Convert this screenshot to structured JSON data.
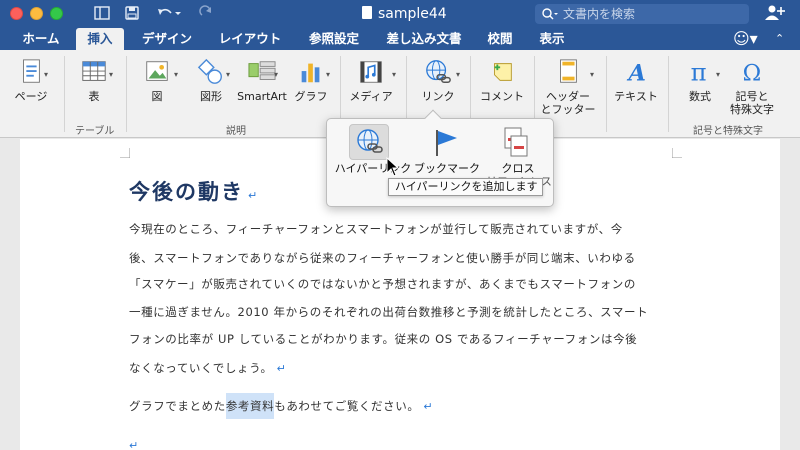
{
  "window": {
    "title": "sample44",
    "search_placeholder": "文書内を検索"
  },
  "tabs": [
    "ホーム",
    "挿入",
    "デザイン",
    "レイアウト",
    "参照設定",
    "差し込み文書",
    "校閲",
    "表示"
  ],
  "active_tab": "挿入",
  "ribbon": {
    "page": "ページ",
    "table": "表",
    "table_group": "テーブル",
    "figure": "図",
    "shapes": "図形",
    "smartart": "SmartArt",
    "graph": "グラフ",
    "illus_group": "説明",
    "media": "メディア",
    "link": "リンク",
    "comment": "コメント",
    "header_footer_1": "ヘッダー",
    "header_footer_2": "とフッター",
    "text": "テキスト",
    "equation": "数式",
    "symbol_1": "記号と",
    "symbol_2": "特殊文字",
    "symbol_group": "記号と特殊文字"
  },
  "popup": {
    "hyperlink": "ハイパーリンク",
    "bookmark": "ブックマーク",
    "crossref_1": "クロス",
    "crossref_2": "リファレンス",
    "tooltip": "ハイパーリンクを追加します"
  },
  "document": {
    "heading": "今後の動き",
    "para_lines": [
      "今現在のところ、フィーチャーフォンとスマートフォンが並行して販売されていますが、今",
      "後、スマートフォンでありながら従来のフィーチャーフォンと使い勝手が同じ端末、いわゆる",
      "「スマケー」が販売されていくのではないかと予想されますが、あくまでもスマートフォンの",
      "一種に過ぎません。2010 年からのそれぞれの出荷台数推移と予測を統計したところ、スマート",
      "フォンの比率が UP していることがわかります。従来の OS であるフィーチャーフォンは今後",
      "なくなっていくでしょう。"
    ],
    "para2_before": "グラフでまとめた",
    "para2_highlight": "参考資料",
    "para2_after": "もあわせてご覧ください。",
    "return_mark": "↵"
  },
  "colors": {
    "title_bar": "#2b5797",
    "heading": "#1f3864",
    "selection": "#cfe2f8"
  }
}
